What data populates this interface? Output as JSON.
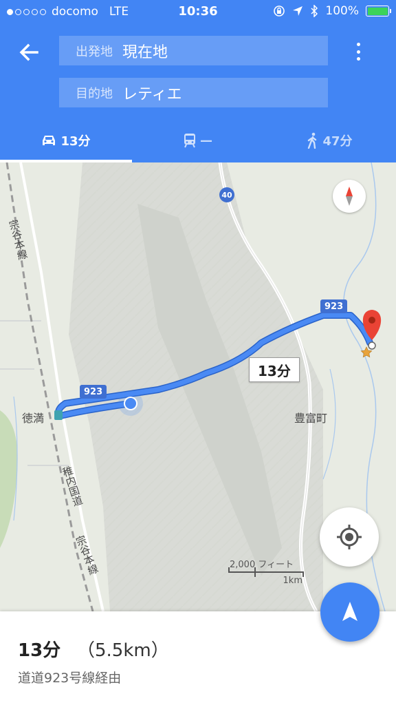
{
  "status_bar": {
    "signal_dots_filled": 1,
    "signal_dots_total": 5,
    "carrier": "docomo",
    "network": "LTE",
    "time": "10:36",
    "battery": "100%"
  },
  "header": {
    "origin_label": "出発地",
    "origin_value": "現在地",
    "destination_label": "目的地",
    "destination_value": "レティエ"
  },
  "tabs": [
    {
      "mode": "car-icon",
      "label": "13分",
      "active": true
    },
    {
      "mode": "train-icon",
      "label": "—",
      "active": false
    },
    {
      "mode": "walk-icon",
      "label": "47分",
      "active": false
    }
  ],
  "map": {
    "route_time": "13分",
    "place_tokumitsu": "徳満",
    "place_toyotomi": "豊富町",
    "rail_line_1": "宗谷本線",
    "rail_line_2": "宗谷本線",
    "national_road": "稚内国道",
    "route_sign_923_a": "923",
    "route_sign_923_b": "923",
    "route_sign_40": "40",
    "scale_feet": "2,000 フィート",
    "scale_km": "1km"
  },
  "summary": {
    "duration": "13分",
    "distance": "（5.5km）",
    "via": "道道923号線経由"
  },
  "colors": {
    "header_blue": "#4285f4",
    "route_blue": "#4a8af4",
    "destination_red": "#ea4335",
    "battery_green": "#3cd35a"
  }
}
